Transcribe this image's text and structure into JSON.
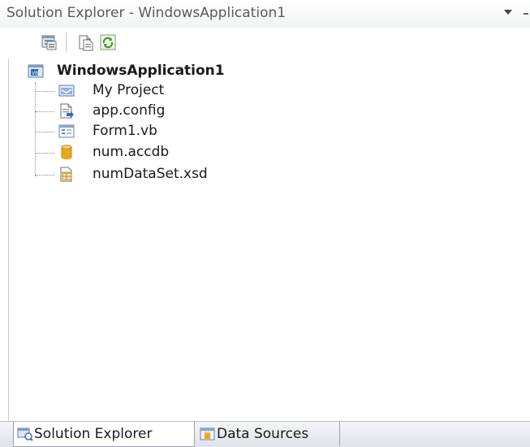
{
  "panel": {
    "title": "Solution Explorer - WindowsApplication1"
  },
  "toolbar": {
    "buttons": [
      {
        "icon": "properties-icon"
      },
      {
        "icon": "show-all-files-icon"
      },
      {
        "icon": "refresh-icon"
      }
    ]
  },
  "tree": {
    "root": {
      "label": "WindowsApplication1",
      "icon": "vb-project-icon"
    },
    "items": [
      {
        "label": "My Project",
        "icon": "my-project-icon"
      },
      {
        "label": "app.config",
        "icon": "config-file-icon"
      },
      {
        "label": "Form1.vb",
        "icon": "form-icon"
      },
      {
        "label": "num.accdb",
        "icon": "database-icon"
      },
      {
        "label": "numDataSet.xsd",
        "icon": "dataset-icon"
      }
    ]
  },
  "tabs": [
    {
      "label": "Solution Explorer",
      "icon": "solution-explorer-icon",
      "active": true
    },
    {
      "label": "Data Sources",
      "icon": "data-sources-icon",
      "active": false
    }
  ]
}
